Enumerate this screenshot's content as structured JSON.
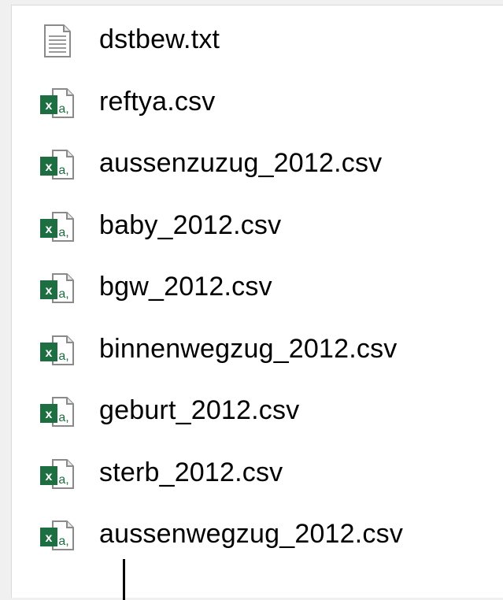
{
  "files": [
    {
      "name": "dstbew.txt",
      "icon": "text-file-icon"
    },
    {
      "name": "reftya.csv",
      "icon": "excel-csv-icon"
    },
    {
      "name": "aussenzuzug_2012.csv",
      "icon": "excel-csv-icon"
    },
    {
      "name": "baby_2012.csv",
      "icon": "excel-csv-icon"
    },
    {
      "name": "bgw_2012.csv",
      "icon": "excel-csv-icon"
    },
    {
      "name": "binnenwegzug_2012.csv",
      "icon": "excel-csv-icon"
    },
    {
      "name": "geburt_2012.csv",
      "icon": "excel-csv-icon"
    },
    {
      "name": "sterb_2012.csv",
      "icon": "excel-csv-icon"
    },
    {
      "name": "aussenwegzug_2012.csv",
      "icon": "excel-csv-icon"
    }
  ],
  "colors": {
    "excel_green": "#1d6f42",
    "background": "#f0f0f0",
    "panel": "#ffffff"
  }
}
